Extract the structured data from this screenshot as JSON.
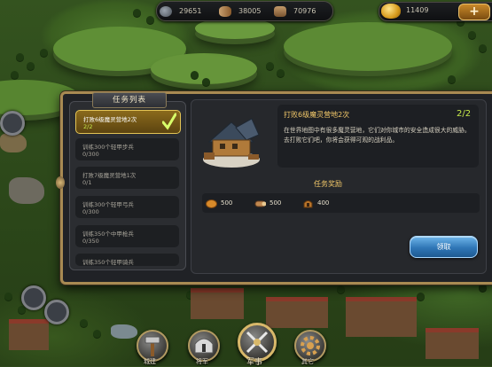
{
  "resources": {
    "food": "29651",
    "wood": "38005",
    "iron": "70976",
    "gold": "11409",
    "gold_plus": "+"
  },
  "task_panel": {
    "title": "任务列表",
    "tasks": [
      {
        "title": "打败6级魔灵营地2次",
        "progress": "2/2"
      },
      {
        "title": "训练300个轻甲步兵",
        "progress": "0/300"
      },
      {
        "title": "打败7级魔灵营地1次",
        "progress": "0/1"
      },
      {
        "title": "训练300个轻甲弓兵",
        "progress": "0/300"
      },
      {
        "title": "训练350个中甲枪兵",
        "progress": "0/350"
      },
      {
        "title": "训练350个轻甲骑兵",
        "progress": ""
      }
    ]
  },
  "detail": {
    "title": "打败6级魔灵营地2次",
    "progress": "2/2",
    "description": "在世界地图中有很多魔灵营地，它们对你城市的安全造成很大的威胁。去打败它们吧，你将会获得可观的战利品。",
    "reward_title": "任务奖励",
    "rewards": [
      {
        "icon": "food-icon",
        "value": "500"
      },
      {
        "icon": "wood-icon",
        "value": "500"
      },
      {
        "icon": "helmet-icon",
        "value": "400"
      }
    ],
    "claim_label": "领取"
  },
  "bottom_menu": {
    "build": "城建",
    "general": "将军",
    "military": "军事",
    "other": "其它"
  },
  "colors": {
    "accent_gold": "#f3c96a",
    "progress_green": "#c6e84a",
    "claim_blue": "#2f76b6"
  }
}
